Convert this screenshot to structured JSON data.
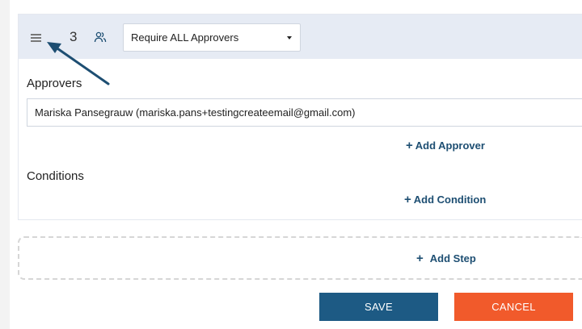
{
  "step": {
    "number": "3",
    "approval_mode": "Require ALL Approvers"
  },
  "approvers": {
    "label": "Approvers",
    "value": "Mariska Pansegrauw (mariska.pans+testingcreateemail@gmail.com)",
    "add_label": "Add Approver"
  },
  "conditions": {
    "label": "Conditions",
    "add_label": "Add Condition"
  },
  "add_step": {
    "label": "Add Step"
  },
  "footer": {
    "save_label": "SAVE",
    "cancel_label": "CANCEL"
  },
  "colors": {
    "primary": "#1d5a84",
    "danger": "#f15a2b",
    "link": "#1d4e72",
    "header_bg": "#e6ebf4"
  },
  "icons": {
    "drag": "hamburger-drag-icon",
    "people": "people-icon",
    "plus": "plus-icon",
    "caret": "caret-down-icon",
    "annotation": "annotation-arrow"
  }
}
